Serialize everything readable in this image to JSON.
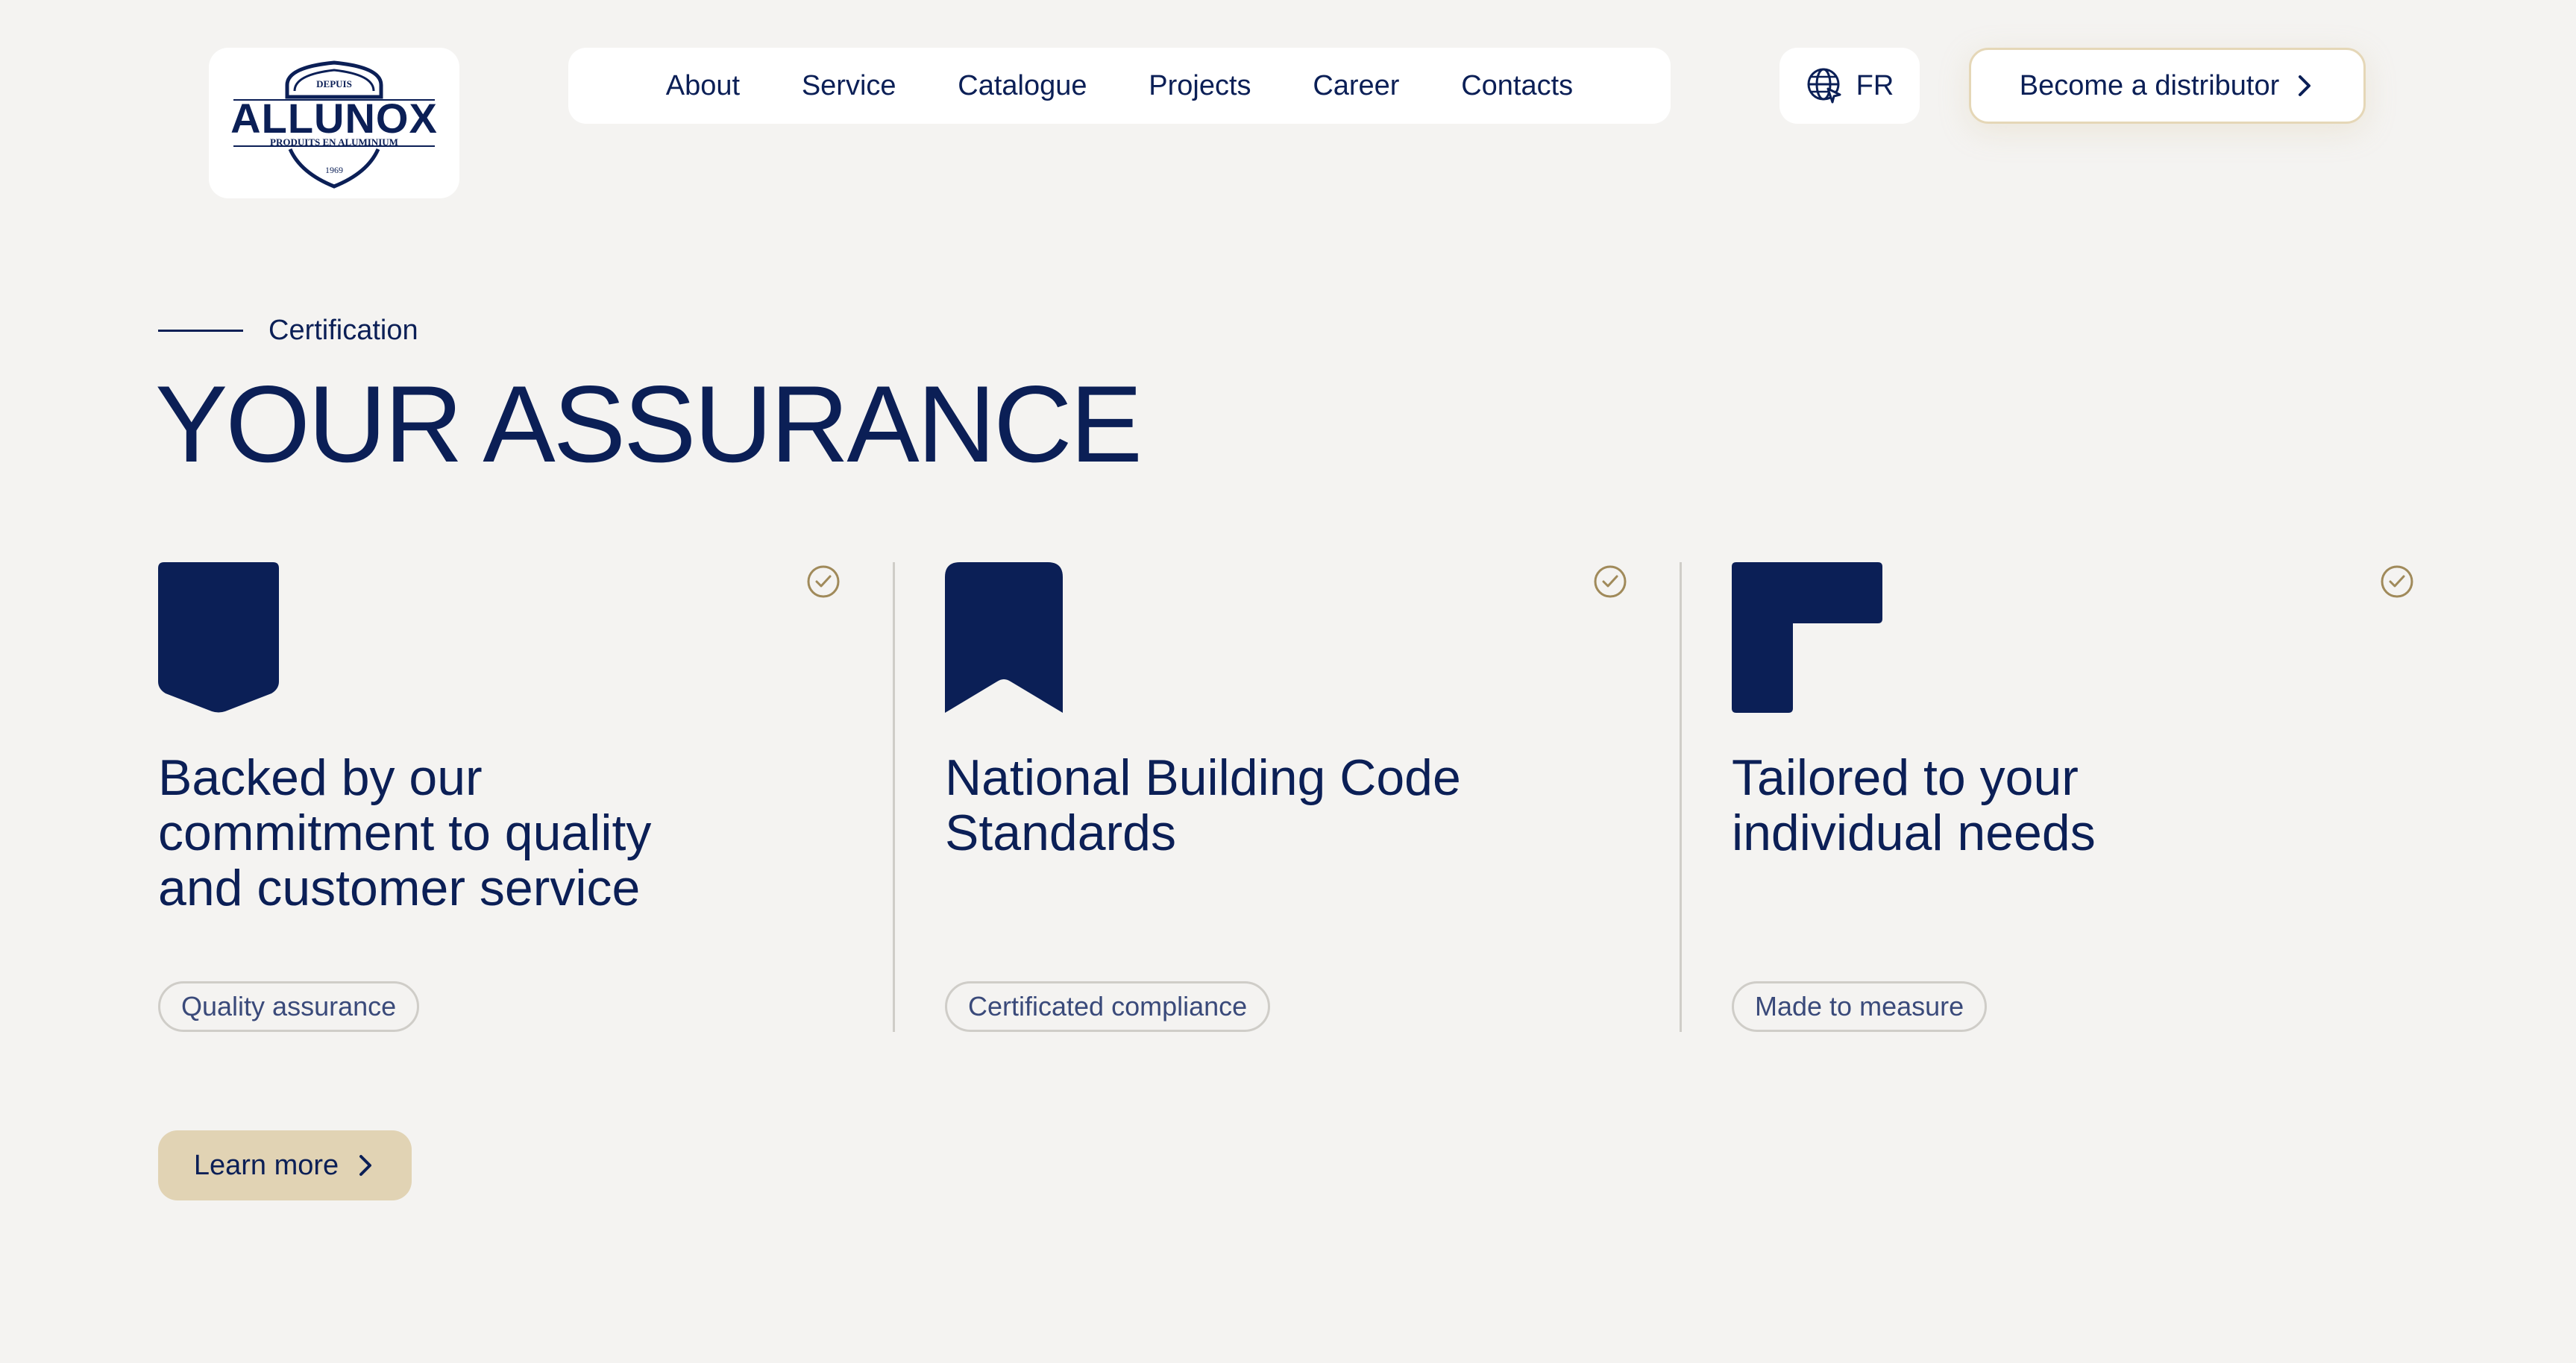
{
  "header": {
    "logo": {
      "top_text": "DEPUIS",
      "brand": "ALLUNOX",
      "tagline": "PRODUITS EN ALUMINIUM",
      "year": "1969"
    },
    "nav": [
      {
        "label": "About"
      },
      {
        "label": "Service"
      },
      {
        "label": "Catalogue"
      },
      {
        "label": "Projects"
      },
      {
        "label": "Career"
      },
      {
        "label": "Contacts"
      }
    ],
    "language": {
      "icon": "globe-icon",
      "code": "FR"
    },
    "distributor_button": {
      "label": "Become a distributor",
      "icon": "chevron-right-icon"
    }
  },
  "section": {
    "eyebrow": "Certification",
    "title": "YOUR ASSURANCE"
  },
  "cards": [
    {
      "icon": "shield-icon",
      "check_icon": "check-circle-icon",
      "title": "Backed by our commitment to quality and customer service",
      "tag": "Quality assurance"
    },
    {
      "icon": "bookmark-icon",
      "check_icon": "check-circle-icon",
      "title": "National Building Code Standards",
      "tag": "Certificated compliance"
    },
    {
      "icon": "corner-bracket-icon",
      "check_icon": "check-circle-icon",
      "title": "Tailored to your individual needs",
      "tag": "Made to measure"
    }
  ],
  "cta": {
    "label": "Learn more",
    "icon": "chevron-right-icon"
  },
  "colors": {
    "background": "#f4f3f1",
    "navy": "#0b1f56",
    "gold": "#a08a5a",
    "button_gold": "#e1d3b4",
    "border_gold": "#e5d7b7"
  }
}
